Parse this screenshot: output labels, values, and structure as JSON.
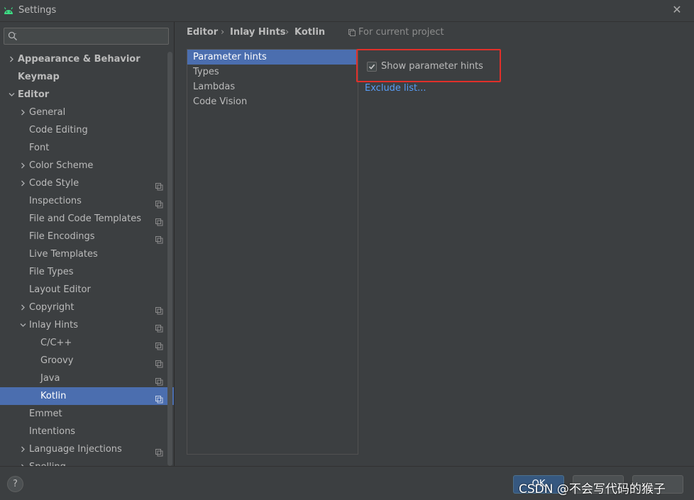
{
  "window": {
    "title": "Settings",
    "close_glyph": "✕"
  },
  "search": {
    "placeholder": "",
    "value": ""
  },
  "sidebar": {
    "items": [
      {
        "label": "Appearance & Behavior",
        "indent": 0,
        "bold": true,
        "arrow": "right",
        "project": false,
        "selected": false
      },
      {
        "label": "Keymap",
        "indent": 0,
        "bold": true,
        "arrow": "none",
        "project": false,
        "selected": false
      },
      {
        "label": "Editor",
        "indent": 0,
        "bold": true,
        "arrow": "down",
        "project": false,
        "selected": false
      },
      {
        "label": "General",
        "indent": 1,
        "bold": false,
        "arrow": "right",
        "project": false,
        "selected": false
      },
      {
        "label": "Code Editing",
        "indent": 1,
        "bold": false,
        "arrow": "none",
        "project": false,
        "selected": false
      },
      {
        "label": "Font",
        "indent": 1,
        "bold": false,
        "arrow": "none",
        "project": false,
        "selected": false
      },
      {
        "label": "Color Scheme",
        "indent": 1,
        "bold": false,
        "arrow": "right",
        "project": false,
        "selected": false
      },
      {
        "label": "Code Style",
        "indent": 1,
        "bold": false,
        "arrow": "right",
        "project": true,
        "selected": false
      },
      {
        "label": "Inspections",
        "indent": 1,
        "bold": false,
        "arrow": "none",
        "project": true,
        "selected": false
      },
      {
        "label": "File and Code Templates",
        "indent": 1,
        "bold": false,
        "arrow": "none",
        "project": true,
        "selected": false
      },
      {
        "label": "File Encodings",
        "indent": 1,
        "bold": false,
        "arrow": "none",
        "project": true,
        "selected": false
      },
      {
        "label": "Live Templates",
        "indent": 1,
        "bold": false,
        "arrow": "none",
        "project": false,
        "selected": false
      },
      {
        "label": "File Types",
        "indent": 1,
        "bold": false,
        "arrow": "none",
        "project": false,
        "selected": false
      },
      {
        "label": "Layout Editor",
        "indent": 1,
        "bold": false,
        "arrow": "none",
        "project": false,
        "selected": false
      },
      {
        "label": "Copyright",
        "indent": 1,
        "bold": false,
        "arrow": "right",
        "project": true,
        "selected": false
      },
      {
        "label": "Inlay Hints",
        "indent": 1,
        "bold": false,
        "arrow": "down",
        "project": true,
        "selected": false
      },
      {
        "label": "C/C++",
        "indent": 2,
        "bold": false,
        "arrow": "none",
        "project": true,
        "selected": false
      },
      {
        "label": "Groovy",
        "indent": 2,
        "bold": false,
        "arrow": "none",
        "project": true,
        "selected": false
      },
      {
        "label": "Java",
        "indent": 2,
        "bold": false,
        "arrow": "none",
        "project": true,
        "selected": false
      },
      {
        "label": "Kotlin",
        "indent": 2,
        "bold": false,
        "arrow": "none",
        "project": true,
        "selected": true
      },
      {
        "label": "Emmet",
        "indent": 1,
        "bold": false,
        "arrow": "none",
        "project": false,
        "selected": false
      },
      {
        "label": "Intentions",
        "indent": 1,
        "bold": false,
        "arrow": "none",
        "project": false,
        "selected": false
      },
      {
        "label": "Language Injections",
        "indent": 1,
        "bold": false,
        "arrow": "right",
        "project": true,
        "selected": false
      },
      {
        "label": "Spelling",
        "indent": 1,
        "bold": false,
        "arrow": "right",
        "project": true,
        "selected": false
      }
    ]
  },
  "breadcrumb": {
    "items": [
      "Editor",
      "Inlay Hints",
      "Kotlin"
    ],
    "separator": "›",
    "scope_note": "For current project"
  },
  "hints_list": {
    "items": [
      "Parameter hints",
      "Types",
      "Lambdas",
      "Code Vision"
    ],
    "selected_index": 0
  },
  "options": {
    "show_parameter_hints_label": "Show parameter hints",
    "show_parameter_hints_checked": true,
    "exclude_list_link": "Exclude list..."
  },
  "footer": {
    "help_label": "?",
    "ok_label": "OK",
    "watermark": "CSDN @不会写代码的猴子"
  },
  "colors": {
    "background": "#3c3f41",
    "selection": "#4b6eaf",
    "link": "#589df6",
    "highlight_box": "#e0302a",
    "android_green": "#3ddc84"
  }
}
